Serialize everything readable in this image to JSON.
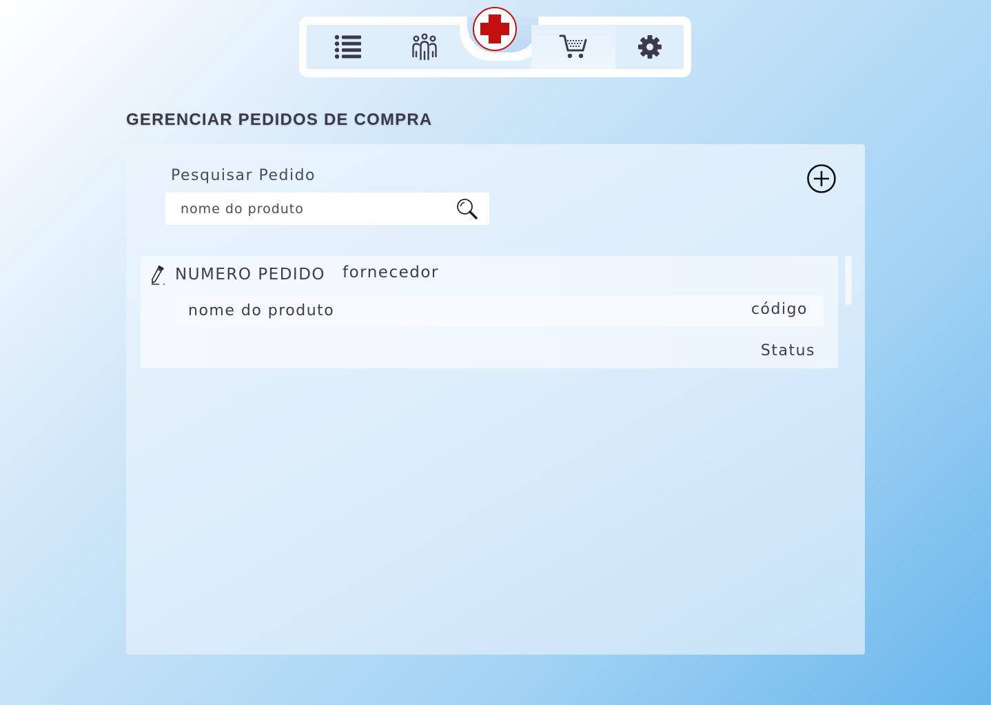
{
  "nav": {
    "items": [
      {
        "icon": "list-icon",
        "active": false
      },
      {
        "icon": "team-icon",
        "active": false
      },
      {
        "icon": "cart-icon",
        "active": true
      },
      {
        "icon": "gear-icon",
        "active": false
      }
    ],
    "logo_icon": "red-cross-icon",
    "accent_color": "#c30f0f"
  },
  "page": {
    "title": "GERENCIAR PEDIDOS DE COMPRA"
  },
  "search": {
    "label": "Pesquisar Pedido",
    "placeholder": "nome do produto",
    "value": ""
  },
  "orders": [
    {
      "number": "NUMERO PEDIDO",
      "supplier": "fornecedor",
      "product_name": "nome do produto",
      "product_code": "código",
      "status": "Status"
    }
  ],
  "colors": {
    "text": "#3d3d4e",
    "background_start": "#ffffff",
    "background_end": "#68b6ec"
  }
}
